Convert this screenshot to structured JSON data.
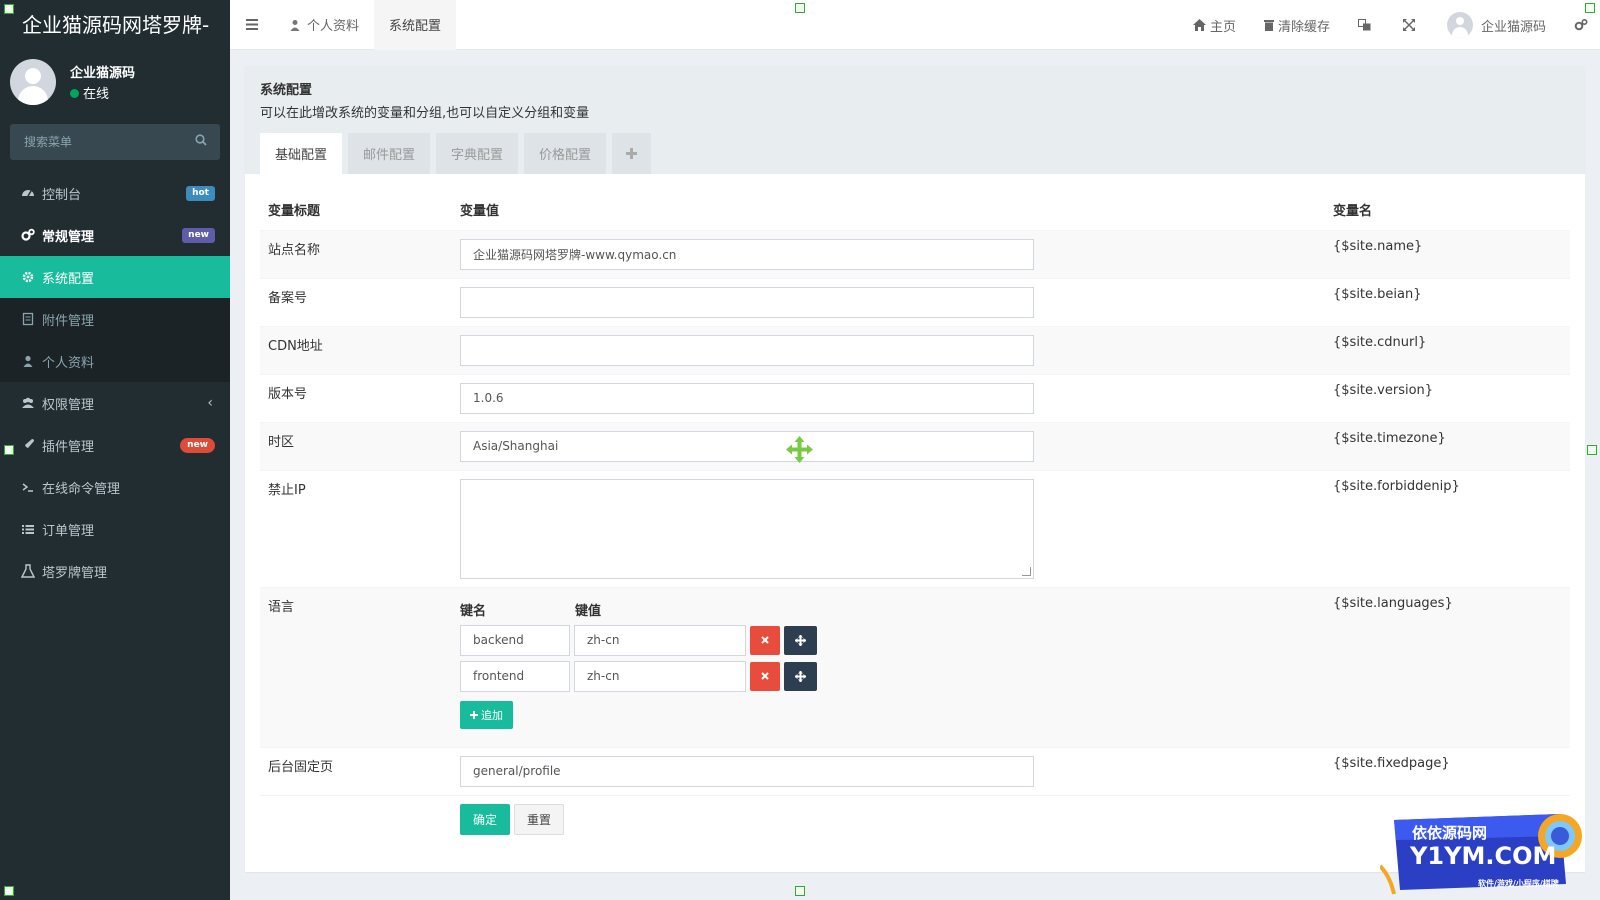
{
  "app": {
    "title": "企业猫源码网塔罗牌-"
  },
  "user": {
    "name": "企业猫源码",
    "status": "在线"
  },
  "sidebar": {
    "search_placeholder": "搜索菜单",
    "items": [
      {
        "label": "控制台",
        "badge": "hot",
        "icon": "dashboard-icon"
      },
      {
        "label": "常规管理",
        "badge": "new",
        "icon": "cogs-icon"
      },
      {
        "label": "系统配置",
        "icon": "gear-icon"
      },
      {
        "label": "附件管理",
        "icon": "file-icon"
      },
      {
        "label": "个人资料",
        "icon": "user-icon"
      },
      {
        "label": "权限管理",
        "icon": "group-icon"
      },
      {
        "label": "插件管理",
        "badge": "new",
        "icon": "rocket-icon"
      },
      {
        "label": "在线命令管理",
        "icon": "terminal-icon"
      },
      {
        "label": "订单管理",
        "icon": "list-icon"
      },
      {
        "label": "塔罗牌管理",
        "icon": "flask-icon"
      }
    ]
  },
  "navbar": {
    "tabs": [
      {
        "label": "个人资料"
      },
      {
        "label": "系统配置"
      }
    ],
    "home": "主页",
    "clear_cache": "清除缓存",
    "username": "企业猫源码"
  },
  "panel": {
    "title": "系统配置",
    "description": "可以在此增改系统的变量和分组,也可以自定义分组和变量",
    "tabs": [
      "基础配置",
      "邮件配置",
      "字典配置",
      "价格配置"
    ]
  },
  "table": {
    "headers": {
      "title": "变量标题",
      "value": "变量值",
      "name": "变量名"
    },
    "rows": [
      {
        "title": "站点名称",
        "value": "企业猫源码网塔罗牌-www.qymao.cn",
        "name": "{$site.name}"
      },
      {
        "title": "备案号",
        "value": "",
        "name": "{$site.beian}"
      },
      {
        "title": "CDN地址",
        "value": "",
        "name": "{$site.cdnurl}"
      },
      {
        "title": "版本号",
        "value": "1.0.6",
        "name": "{$site.version}"
      },
      {
        "title": "时区",
        "value": "Asia/Shanghai",
        "name": "{$site.timezone}"
      },
      {
        "title": "禁止IP",
        "value": "",
        "name": "{$site.forbiddenip}"
      },
      {
        "title": "语言",
        "name": "{$site.languages}"
      },
      {
        "title": "后台固定页",
        "value": "general/profile",
        "name": "{$site.fixedpage}"
      }
    ],
    "languages": {
      "key_header": "键名",
      "value_header": "键值",
      "pairs": [
        {
          "key": "backend",
          "value": "zh-cn"
        },
        {
          "key": "frontend",
          "value": "zh-cn"
        }
      ],
      "add_label": "追加"
    }
  },
  "actions": {
    "confirm": "确定",
    "reset": "重置"
  },
  "watermark": {
    "line1": "依依源码网",
    "line2": "Y1YM.COM",
    "line3": "软件/游戏/小程序/棋牌"
  },
  "colors": {
    "accent": "#18bc9c",
    "sidebar_bg": "#222d32",
    "danger": "#e74c3c",
    "dark": "#2c3e50"
  }
}
